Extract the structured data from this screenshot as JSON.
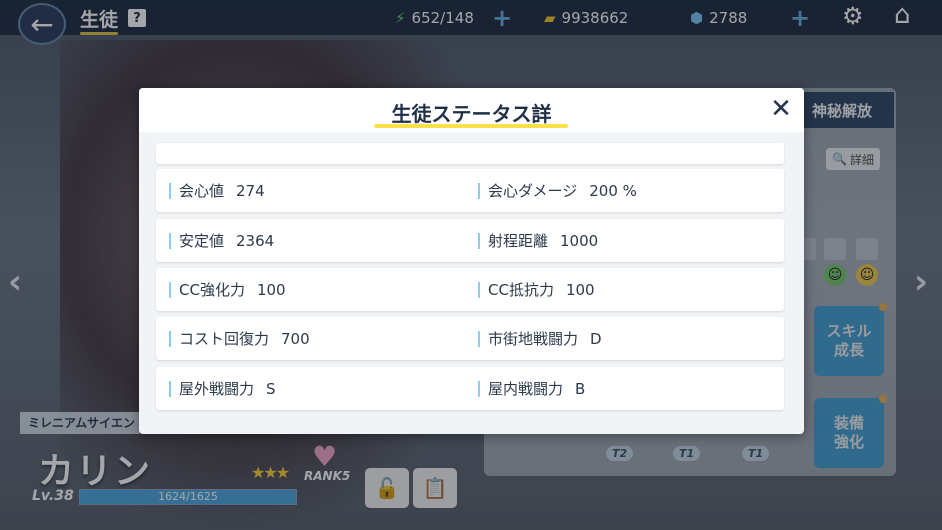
{
  "header": {
    "title": "生徒",
    "help_icon": "?",
    "ap": "652/148",
    "credits": "9938662",
    "gems": "2788",
    "back_icon": "←",
    "settings_icon": "gear-icon",
    "home_icon": "home-icon"
  },
  "background": {
    "tab_label": "神秘解放",
    "detail_label": "詳細",
    "skill_label": "スキル\n成長",
    "equip_label": "装備\n強化",
    "tags": [
      "T2",
      "T1",
      "T1"
    ]
  },
  "character": {
    "affiliation": "ミレニアムサイエン",
    "name": "カリン",
    "level": "Lv.38",
    "exp_text": "1624/1625",
    "exp_ratio": 0.999,
    "stars": "★★★",
    "rank": "RANK5"
  },
  "modal": {
    "title": "生徒ステータス詳",
    "close_icon": "✕",
    "rows": [
      {
        "left_label": "会心値",
        "left_value": "274",
        "right_label": "会心ダメージ",
        "right_value": "200 %"
      },
      {
        "left_label": "安定値",
        "left_value": "2364",
        "right_label": "射程距離",
        "right_value": "1000"
      },
      {
        "left_label": "CC強化力",
        "left_value": "100",
        "right_label": "CC抵抗力",
        "right_value": "100"
      },
      {
        "left_label": "コスト回復力",
        "left_value": "700",
        "right_label": "市街地戦闘力",
        "right_value": "D"
      },
      {
        "left_label": "屋外戦闘力",
        "left_value": "S",
        "right_label": "屋内戦闘力",
        "right_value": "B"
      }
    ]
  },
  "colors": {
    "accent_yellow": "#ffe04a",
    "label_bar": "#8ccdf0",
    "topbar": "#18253c"
  }
}
